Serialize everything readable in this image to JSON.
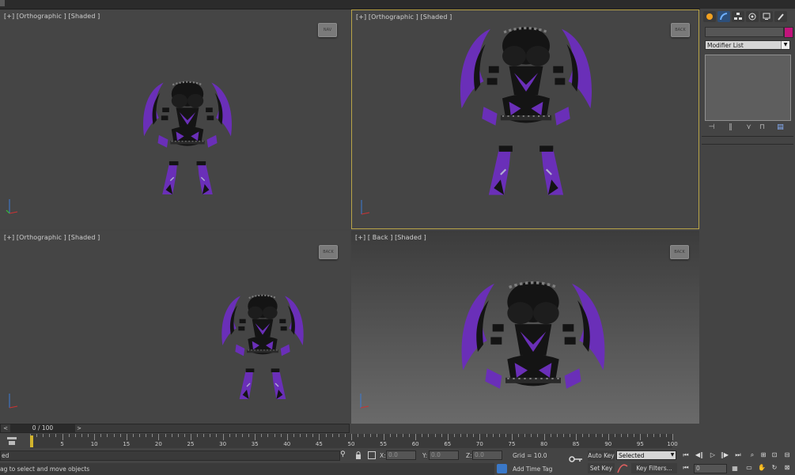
{
  "viewports": {
    "top_left": {
      "label": "[+] [Orthographic ] [Shaded ]"
    },
    "top_right": {
      "label": "[+] [Orthographic ] [Shaded ]"
    },
    "bottom_left": {
      "label": "[+] [Orthographic ] [Shaded ]"
    },
    "bottom_right": {
      "label": "[+] [ Back ] [Shaded ]"
    }
  },
  "command_panel": {
    "modifier_list": "Modifier List",
    "object_color": "#c1147b"
  },
  "timeline": {
    "slider_label": "0 / 100",
    "prev_arrow": "<",
    "next_arrow": ">",
    "ruler_labels": [
      "5",
      "10",
      "15",
      "20",
      "25",
      "30",
      "35",
      "40",
      "45",
      "50",
      "55",
      "60",
      "65",
      "70",
      "75",
      "80",
      "85",
      "90",
      "95",
      "100"
    ]
  },
  "status": {
    "selection_text": "ed",
    "prompt_text": "ag to select and move objects",
    "x_label": "X:",
    "x_value": "0.0",
    "y_label": "Y:",
    "y_value": "0.0",
    "z_label": "Z:",
    "z_value": "0.0",
    "grid": "Grid = 10.0",
    "add_time_tag": "Add Time Tag"
  },
  "animation": {
    "auto_key": "Auto Key",
    "set_key": "Set Key",
    "selected": "Selected",
    "key_filters": "Key Filters...",
    "frame_value": "0"
  },
  "colors": {
    "active_border": "#b9a448",
    "model_purple": "#6a2fb8",
    "model_black": "#141414"
  }
}
